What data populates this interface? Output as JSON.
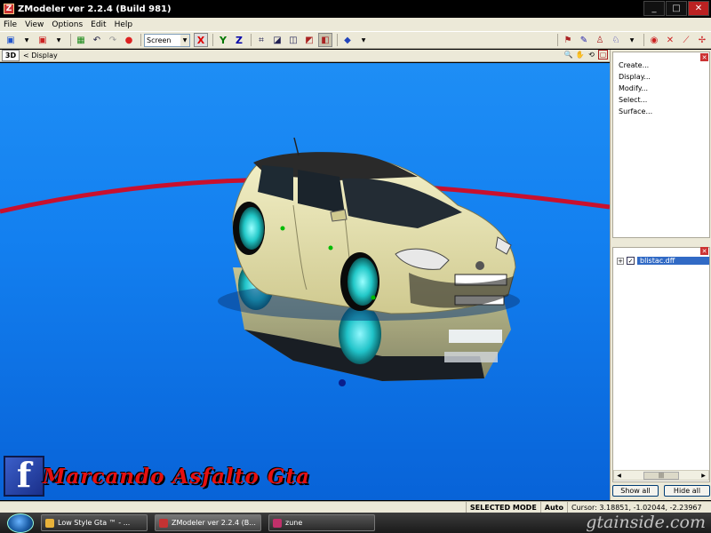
{
  "window": {
    "title": "ZModeler ver 2.2.4 (Build 981)",
    "logo_glyph": "Z",
    "controls": {
      "minimize": "_",
      "maximize": "□",
      "close": "✕"
    }
  },
  "menu": [
    "File",
    "View",
    "Options",
    "Edit",
    "Help"
  ],
  "toolbar": {
    "coord_select": "Screen",
    "axes": [
      "X",
      "Y",
      "Z"
    ]
  },
  "viewport": {
    "mode_button": "3D",
    "label": "< Display",
    "background_color": "#1380f0",
    "ground_ring_color": "#c8102e"
  },
  "commands": {
    "items": [
      "Create...",
      "Display...",
      "Modify...",
      "Select...",
      "Surface..."
    ]
  },
  "scene": {
    "expander": "+",
    "checked": "✓",
    "file_name": "blistac.dff",
    "scroll_grip": "|||",
    "show_all": "Show all",
    "hide_all": "Hide all"
  },
  "status": {
    "mode": "SELECTED MODE",
    "auto": "Auto",
    "cursor": "Cursor: 3.18851, -1.02044, -2.23967"
  },
  "overlay": {
    "brand_letter": "f",
    "brand_text": "Marcando Asfalto Gta"
  },
  "taskbar": {
    "tasks": [
      {
        "label": "Low Style Gta ™ - ...",
        "color": "#e8b23a"
      },
      {
        "label": "ZModeler ver 2.2.4 (B...",
        "color": "#c33333"
      },
      {
        "label": "zune",
        "color": "#c0306a"
      }
    ],
    "watermark": "gtainside.com"
  }
}
